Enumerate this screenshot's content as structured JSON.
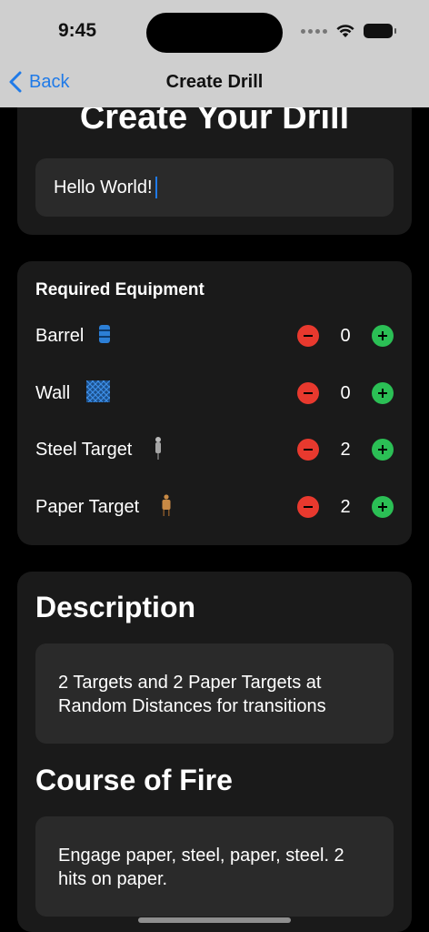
{
  "status": {
    "time": "9:45"
  },
  "nav": {
    "back_label": "Back",
    "title": "Create Drill"
  },
  "header": {
    "title": "Create Your Drill"
  },
  "drill_name": {
    "value": "Hello World!"
  },
  "equipment": {
    "label": "Required Equipment",
    "items": [
      {
        "name": "Barrel",
        "icon": "barrel-icon",
        "count": "0"
      },
      {
        "name": "Wall",
        "icon": "wall-icon",
        "count": "0"
      },
      {
        "name": "Steel Target",
        "icon": "steel-target-icon",
        "count": "2"
      },
      {
        "name": "Paper Target",
        "icon": "paper-target-icon",
        "count": "2"
      }
    ]
  },
  "description": {
    "heading": "Description",
    "text": "2 Targets and 2 Paper Targets at Random Distances for transitions"
  },
  "course_of_fire": {
    "heading": "Course of Fire",
    "text": "Engage paper, steel, paper, steel. 2 hits on paper."
  },
  "colors": {
    "accent": "#1f7ae8",
    "minus": "#e8392e",
    "plus": "#2bbf55",
    "card": "#1a1a1a",
    "field": "#2a2a2a"
  }
}
